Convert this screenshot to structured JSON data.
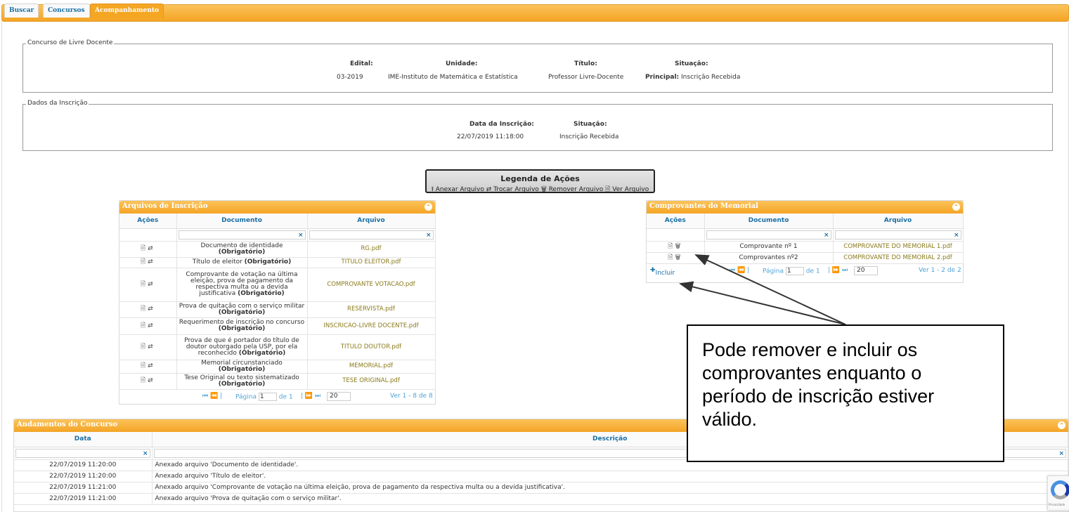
{
  "tabs": [
    "Buscar",
    "Concursos",
    "Acompanhamento"
  ],
  "concurso": {
    "legend": "Concurso de Livre Docente",
    "edital_label": "Edital:",
    "edital_value": "03-2019",
    "unidade_label": "Unidade:",
    "unidade_value": "IME-Instituto de Matemática e Estatística",
    "titulo_label": "Título:",
    "titulo_value": "Professor Livre-Docente",
    "situacao_label": "Situação:",
    "situacao_prefix": "Principal:",
    "situacao_value": "Inscrição Recebida"
  },
  "inscricao": {
    "legend": "Dados da Inscrição",
    "data_label": "Data da Inscrição:",
    "data_value": "22/07/2019 11:18:00",
    "situacao_label": "Situação:",
    "situacao_value": "Inscrição Recebida"
  },
  "legenda": {
    "title": "Legenda de Ações",
    "items": [
      "Anexar Arquivo",
      "Trocar Arquivo",
      "Remover Arquivo",
      "Ver Arquivo"
    ]
  },
  "arquivos": {
    "title": "Arquivos de Inscrição",
    "columns": [
      "Ações",
      "Documento",
      "Arquivo"
    ],
    "filter_clear": "×",
    "pager": {
      "page_label": "Página",
      "page_value": "1",
      "of_label": "de 1",
      "page_size": "20",
      "summary": "Ver 1 - 8 de 8"
    }
  },
  "comprovantes": {
    "title": "Comprovantes do Memorial",
    "columns": [
      "Ações",
      "Documento",
      "Arquivo"
    ],
    "rows": [
      {
        "doc": "Comprovante nº 1",
        "file": "COMPROVANTE DO MEMORIAL 1.pdf"
      },
      {
        "doc": "Comprovantes nº2",
        "file": "COMPROVANTE DO MEMORIAL 2.pdf"
      }
    ],
    "include_label": "Incluir",
    "pager": {
      "page_label": "Página",
      "page_value": "1",
      "of_label": "de 1",
      "page_size": "20",
      "summary": "Ver 1 - 2 de 2"
    }
  },
  "andamentos": {
    "title": "Andamentos do Concurso",
    "columns": [
      "Data",
      "Descrição"
    ],
    "rows": [
      {
        "date": "22/07/2019 11:20:00",
        "desc": "Anexado arquivo 'Documento de identidade'."
      },
      {
        "date": "22/07/2019 11:20:00",
        "desc": "Anexado arquivo 'Título de eleitor'."
      },
      {
        "date": "22/07/2019 11:21:00",
        "desc": "Anexado arquivo 'Comprovante de votação na última eleição, prova de pagamento da respectiva multa ou a devida justificativa'."
      },
      {
        "date": "22/07/2019 11:21:00",
        "desc": "Anexado arquivo 'Prova de quitação com o serviço militar'."
      }
    ]
  },
  "callout": {
    "text": "Pode remover e incluir os comprovantes enquanto o período de inscrição estiver válido."
  },
  "recaptcha": {
    "text": "Privacidade"
  },
  "colors": {
    "accent": "#f5a623",
    "link": "#1a6fa6",
    "file": "#8a7a1a"
  }
}
